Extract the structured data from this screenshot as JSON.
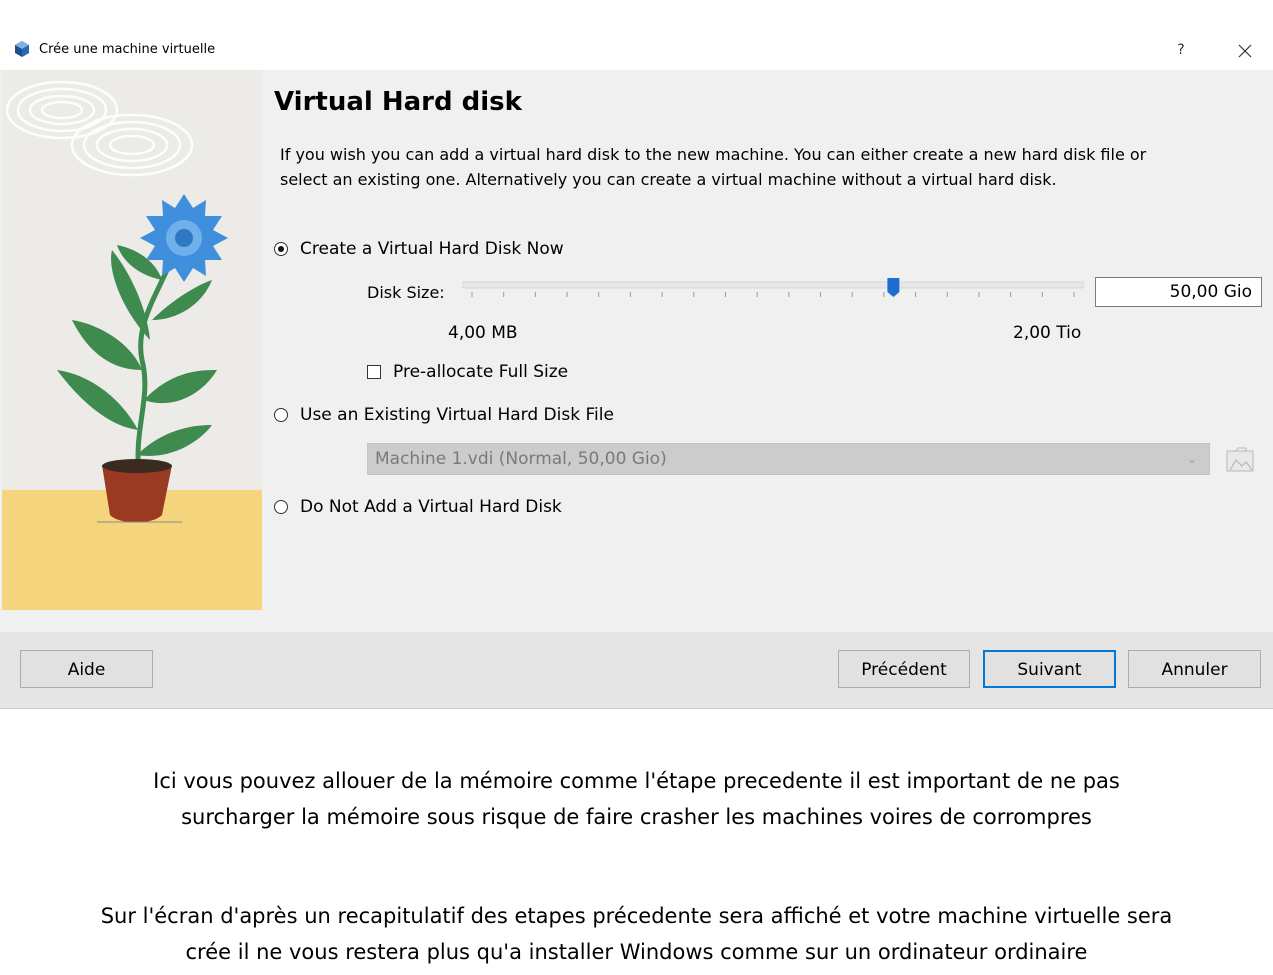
{
  "window": {
    "title": "Crée une machine virtuelle",
    "help_glyph": "?",
    "close_glyph": "×"
  },
  "page": {
    "heading": "Virtual Hard disk",
    "description": "If you wish you can add a virtual hard disk to the new machine. You can either create a new hard disk file or select an existing one. Alternatively you can create a virtual machine without a virtual hard disk."
  },
  "options": {
    "create_now": {
      "label": "Create a Virtual Hard Disk Now",
      "selected": true
    },
    "use_existing": {
      "label": "Use an Existing Virtual Hard Disk File",
      "selected": false
    },
    "no_disk": {
      "label": "Do Not Add a Virtual Hard Disk",
      "selected": false
    }
  },
  "disk_size": {
    "label": "Disk Size:",
    "value": "50,00 Gio",
    "min_label": "4,00 MB",
    "max_label": "2,00 Tio",
    "slider_fraction": 0.7,
    "tick_count": 20
  },
  "preallocate": {
    "label": "Pre-allocate Full Size",
    "checked": false
  },
  "existing_file": {
    "selected": "Machine 1.vdi (Normal, 50,00 Gio)",
    "enabled": false
  },
  "buttons": {
    "help": "Aide",
    "back": "Précédent",
    "next": "Suivant",
    "cancel": "Annuler"
  },
  "notes": [
    "Ici vous pouvez allouer de la mémoire comme l'étape precedente il est important de ne pas",
    "surcharger la mémoire sous risque de faire crasher les machines voires de corrompres",
    "Sur l'écran d'après un recapitulatif des etapes précedente sera affiché et votre machine virtuelle sera",
    "crée il ne vous restera plus qu'a installer Windows comme sur un ordinateur ordinaire"
  ],
  "colors": {
    "accent": "#0078d7",
    "slider_handle": "#1c6fd0",
    "floor": "#f4d47c",
    "flower": "#3f8fdc",
    "leaf": "#3f8a4f",
    "pot": "#9a3a22"
  },
  "icons": {
    "app": "virtualbox-cube-icon",
    "close": "close-icon",
    "folder": "folder-open-icon",
    "dropdown": "chevron-down-icon"
  }
}
